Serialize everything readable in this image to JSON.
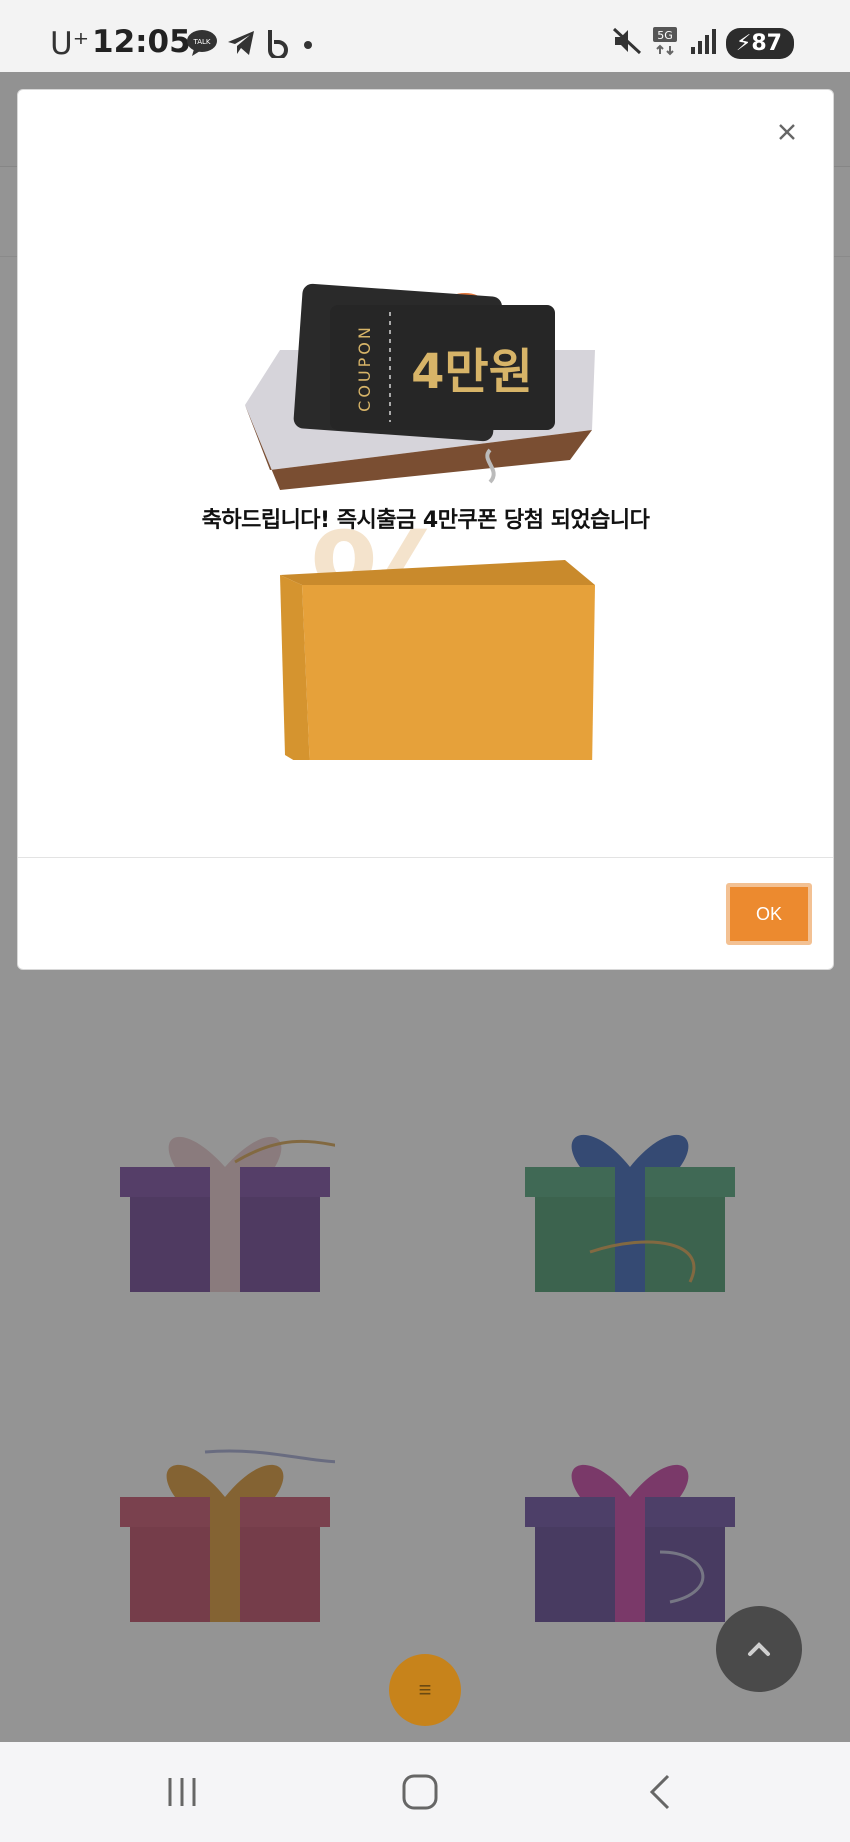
{
  "status_bar": {
    "carrier": "U⁺",
    "time": "12:05",
    "app_icons": [
      "kakaotalk-icon",
      "telegram-icon",
      "band-icon",
      "dot-icon"
    ],
    "network": "5G",
    "battery": "87"
  },
  "modal": {
    "coupon_side_label": "COUPON",
    "coupon_amount": "4만원",
    "message": "축하드립니다! 즉시출금 4만쿠폰 당첨 되었습니다",
    "ok_label": "OK",
    "close_glyph": "×"
  },
  "background": {
    "menu_glyph": "≡",
    "gift_colors": [
      "#5b2a86",
      "#2f8a5a",
      "#b5304f",
      "#4b2d86"
    ]
  },
  "colors": {
    "accent": "#ec8a2f",
    "dim_overlay": "rgba(70,70,70,0.58)"
  }
}
